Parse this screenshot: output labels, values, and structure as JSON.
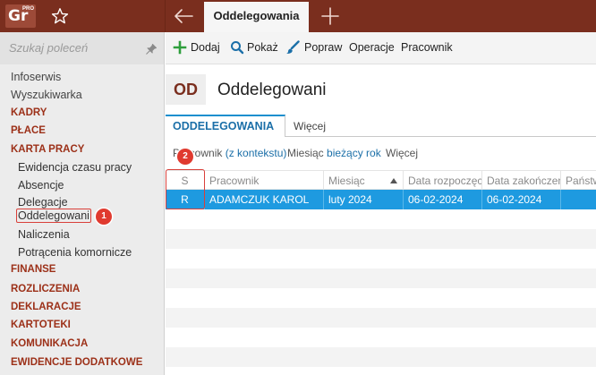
{
  "topbar": {
    "logo_text": "Gr",
    "logo_badge": "PRO",
    "active_tab": "Oddelegowania"
  },
  "sidebar": {
    "search_placeholder": "Szukaj poleceń",
    "top_items": [
      "Infoserwis",
      "Wyszukiwarka"
    ],
    "sections_a": [
      "KADRY",
      "PŁACE",
      "KARTA PRACY"
    ],
    "karta_pracy_items": [
      "Ewidencja czasu pracy",
      "Absencje",
      "Delegacje",
      "Oddelegowani",
      "Naliczenia",
      "Potrącenia komornicze"
    ],
    "sections_b": [
      "FINANSE",
      "ROZLICZENIA",
      "DEKLARACJE",
      "KARTOTEKI",
      "KOMUNIKACJA",
      "EWIDENCJE DODATKOWE"
    ]
  },
  "toolbar": {
    "add_label": "Dodaj",
    "show_label": "Pokaż",
    "fix_label": "Popraw",
    "operations_label": "Operacje",
    "employee_label": "Pracownik"
  },
  "page": {
    "badge": "OD",
    "title": "Oddelegowani",
    "tab_main": "ODDELEGOWANIA",
    "tab_more": "Więcej"
  },
  "filters": {
    "employee_label": "Pracownik",
    "employee_value": "(z kontekstu)",
    "month_label": "Miesiąc",
    "month_value": "bieżący rok",
    "more": "Więcej"
  },
  "grid": {
    "columns": [
      "S",
      "Pracownik",
      "Miesiąc",
      "Data rozpoczęcia",
      "Data zakończenia",
      "Państwo"
    ],
    "sort_column": "Miesiąc",
    "rows": [
      {
        "s": "R",
        "employee": "ADAMCZUK KAROL",
        "month": "luty 2024",
        "start": "06-02-2024",
        "end": "06-02-2024",
        "country": ""
      }
    ]
  },
  "annotations": {
    "step1": "1",
    "step2": "2"
  },
  "colors": {
    "brand": "#7a2e1e",
    "section": "#9c3018",
    "accent": "#1b8fce",
    "selected_row": "#1e9ae0",
    "callout": "#e03a2f"
  }
}
